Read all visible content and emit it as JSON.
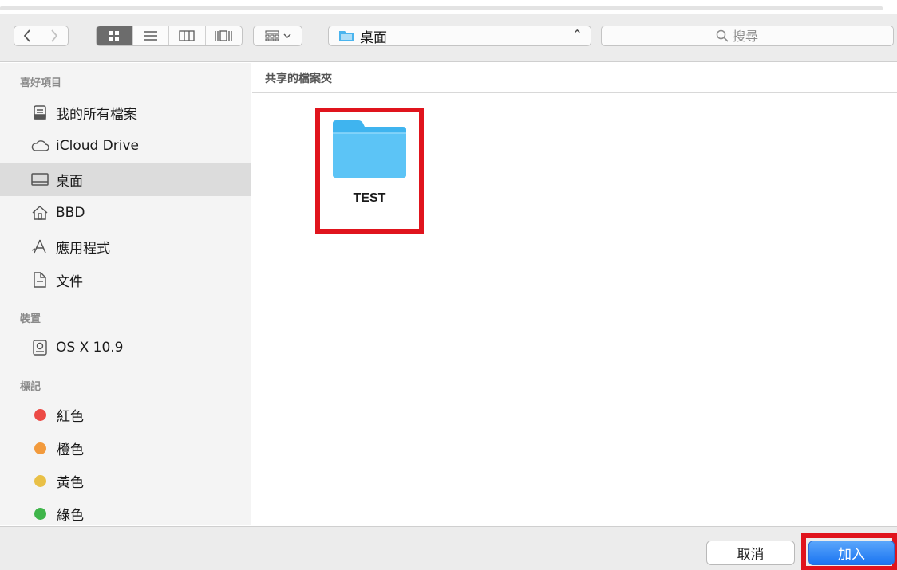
{
  "toolbar": {
    "path_popup_label": "桌面",
    "search_placeholder": "搜尋"
  },
  "sidebar": {
    "favorites_header": "喜好項目",
    "favorites": [
      {
        "label": "我的所有檔案",
        "icon": "all-files-icon"
      },
      {
        "label": "iCloud Drive",
        "icon": "cloud-icon"
      },
      {
        "label": "桌面",
        "icon": "desktop-icon",
        "selected": true
      },
      {
        "label": "BBD",
        "icon": "home-icon"
      },
      {
        "label": "應用程式",
        "icon": "applications-icon"
      },
      {
        "label": "文件",
        "icon": "documents-icon"
      }
    ],
    "devices_header": "裝置",
    "devices": [
      {
        "label": "OS X 10.9",
        "icon": "disk-icon"
      }
    ],
    "tags_header": "標記",
    "tags": [
      {
        "label": "紅色",
        "color": "#ec4a45"
      },
      {
        "label": "橙色",
        "color": "#f29a3c"
      },
      {
        "label": "黃色",
        "color": "#e9c046"
      },
      {
        "label": "綠色",
        "color": "#3fb54a"
      }
    ]
  },
  "main": {
    "header": "共享的檔案夾",
    "files": [
      {
        "name": "TEST",
        "type": "folder",
        "highlighted": true
      }
    ]
  },
  "footer": {
    "cancel_label": "取消",
    "add_label": "加入",
    "add_highlighted": true
  },
  "colors": {
    "highlight_box": "#e0141d",
    "folder": "#5cc4f6",
    "primary_button": "#1a74f1"
  }
}
